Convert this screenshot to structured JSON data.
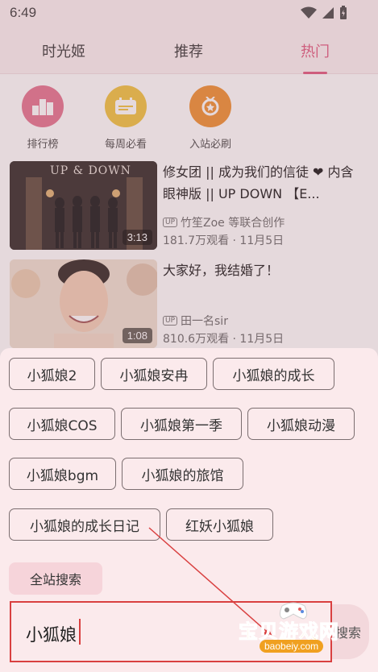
{
  "status_bar": {
    "time": "6:49"
  },
  "tabs": [
    {
      "label": "时光姬"
    },
    {
      "label": "推荐"
    },
    {
      "label": "热门"
    }
  ],
  "quick_links": [
    {
      "label": "排行榜",
      "icon": "podium-icon",
      "color": "#e46f8c"
    },
    {
      "label": "每周必看",
      "icon": "calendar-ticket-icon",
      "color": "#f0c23a"
    },
    {
      "label": "入站必刷",
      "icon": "medal-icon",
      "color": "#ef8c2a"
    }
  ],
  "videos": [
    {
      "title": "修女团 || 成为我们的信徒 ❤ 内含眼神版 || UP DOWN 【E...",
      "author": "竹笙Zoe 等联合创作",
      "meta": "181.7万观看 · 11月5日",
      "duration": "3:13",
      "thumb_text": "UP & DOWN"
    },
    {
      "title": "大家好，我结婚了！",
      "author": "田一名sir",
      "meta": "810.6万观看 · 11月5日",
      "duration": "1:08"
    }
  ],
  "up_badge": "UP",
  "suggestions": [
    "小狐娘2",
    "小狐娘安冉",
    "小狐娘的成长",
    "小狐娘COS",
    "小狐娘第一季",
    "小狐娘动漫",
    "小狐娘bgm",
    "小狐娘的旅馆",
    "小狐娘的成长日记",
    "红妖小狐娘"
  ],
  "site_search_label": "全站搜索",
  "search": {
    "value": "小狐娘",
    "button_label": "搜索"
  },
  "watermark": {
    "text": "宝贝游戏网",
    "url": "baobeiy.com"
  },
  "colors": {
    "accent": "#e0557c",
    "highlight": "#d94040"
  }
}
